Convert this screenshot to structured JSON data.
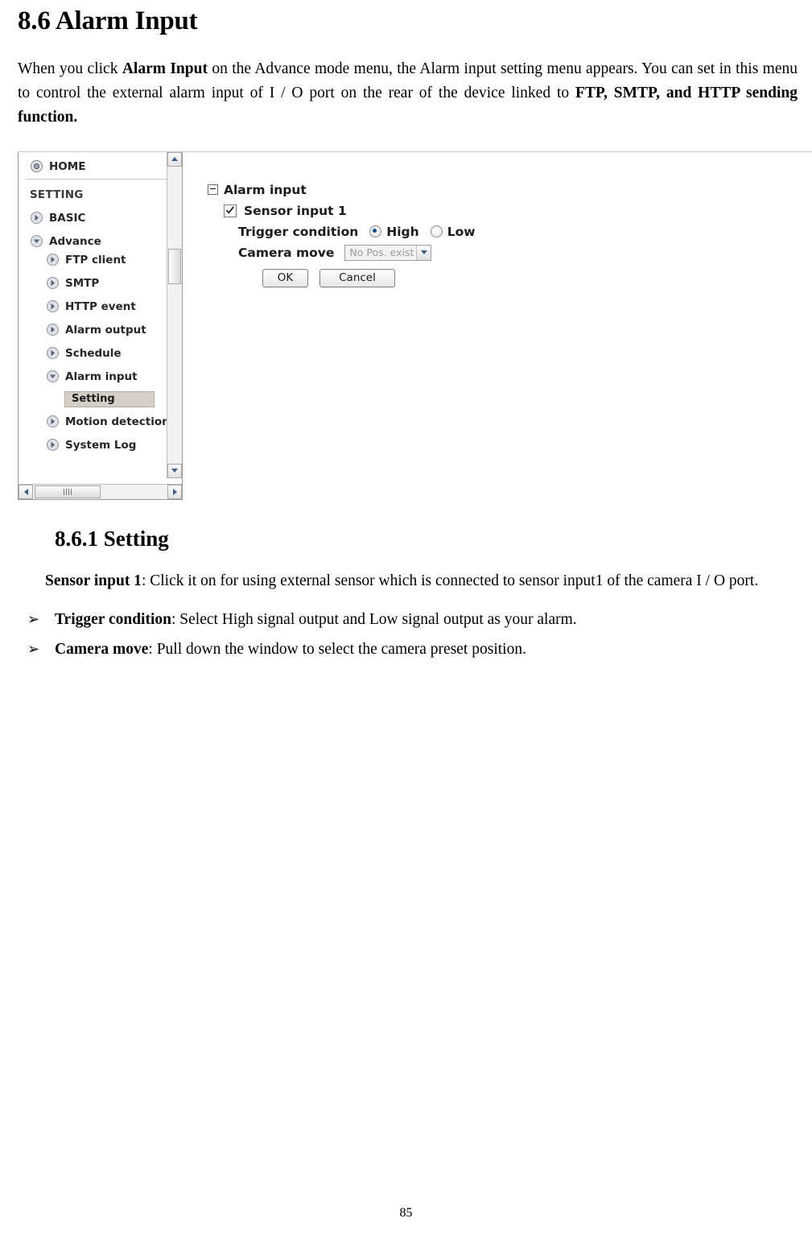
{
  "section": {
    "title": "8.6 Alarm Input",
    "intro_parts": [
      {
        "t": "When you click ",
        "b": false
      },
      {
        "t": "Alarm Input",
        "b": true
      },
      {
        "t": " on the Advance mode menu, the Alarm input setting menu appears. You can set in this menu to control the external alarm input of I / O port on the rear of the device linked to ",
        "b": false
      },
      {
        "t": "FTP, SMTP, and HTTP sending function.",
        "b": true
      }
    ]
  },
  "screenshot": {
    "tree": {
      "home": "HOME",
      "setting_header": "SETTING",
      "items": [
        {
          "label": "BASIC",
          "icon": "arrow-right-icon"
        },
        {
          "label": "Advance",
          "icon": "arrow-down-icon"
        },
        {
          "label": "FTP client",
          "icon": "arrow-right-icon"
        },
        {
          "label": "SMTP",
          "icon": "arrow-right-icon"
        },
        {
          "label": "HTTP event",
          "icon": "arrow-right-icon"
        },
        {
          "label": "Alarm output",
          "icon": "arrow-right-icon"
        },
        {
          "label": "Schedule",
          "icon": "arrow-right-icon"
        },
        {
          "label": "Alarm input",
          "icon": "arrow-down-icon"
        },
        {
          "label": "Motion detection",
          "icon": "arrow-right-icon"
        },
        {
          "label": "System Log",
          "icon": "arrow-right-icon"
        }
      ],
      "selected_child": "Setting"
    },
    "form": {
      "group_title": "Alarm input",
      "sensor_input_label": "Sensor input 1",
      "sensor_input_checked": true,
      "trigger_condition_label": "Trigger condition",
      "trigger_high_label": "High",
      "trigger_low_label": "Low",
      "trigger_selected": "High",
      "camera_move_label": "Camera move",
      "camera_move_value": "No Pos. exist",
      "ok_label": "OK",
      "cancel_label": "Cancel"
    }
  },
  "subsection": {
    "title": "8.6.1 Setting",
    "paragraph_parts": [
      {
        "t": "Sensor input 1",
        "b": true
      },
      {
        "t": ": Click it on for using external sensor which is connected to sensor input1 of the camera I / O port.",
        "b": false
      }
    ],
    "bullets": [
      {
        "marker": "➢",
        "parts": [
          {
            "t": "Trigger condition",
            "b": true
          },
          {
            "t": ": Select High signal output and Low signal output as your alarm.",
            "b": false
          }
        ]
      },
      {
        "marker": "➢",
        "parts": [
          {
            "t": "Camera move",
            "b": true
          },
          {
            "t": ": Pull down the window to select the camera preset position.",
            "b": false
          }
        ]
      }
    ]
  },
  "footer": {
    "page_number": "85"
  }
}
